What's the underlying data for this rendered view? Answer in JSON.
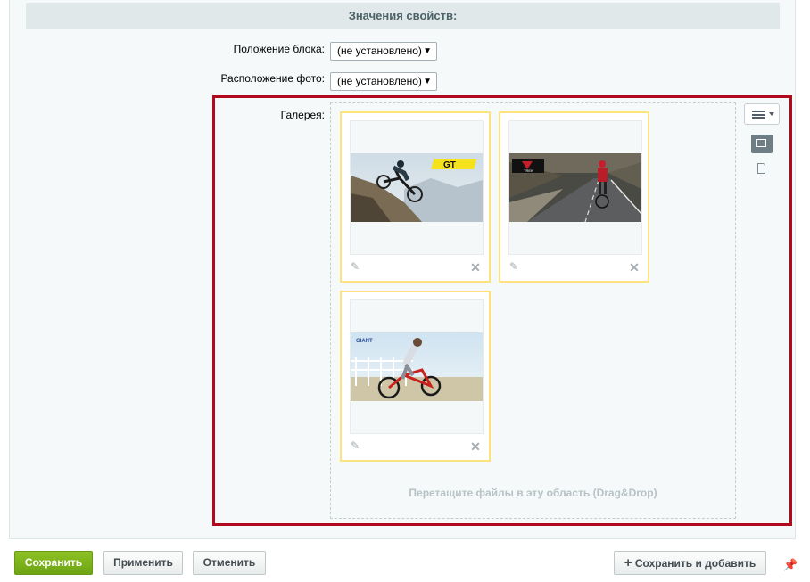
{
  "section": {
    "title": "Значения свойств:"
  },
  "fields": [
    {
      "label": "Положение блока:",
      "value": "(не установлено)"
    },
    {
      "label": "Расположение фото:",
      "value": "(не установлено)"
    }
  ],
  "gallery": {
    "label": "Галерея:",
    "dropzone_text": "Перетащите файлы в эту область (Drag&Drop)",
    "photos": [
      {
        "brand": "GT"
      },
      {
        "brand": "TREK"
      },
      {
        "brand": "GIANT"
      }
    ]
  },
  "icons": {
    "menu": "menu-icon",
    "grid_view": "image-view-icon",
    "file_view": "file-view-icon",
    "edit": "pencil-icon",
    "delete": "close-icon",
    "pin": "pin-icon"
  },
  "footer": {
    "save": "Сохранить",
    "apply": "Применить",
    "cancel": "Отменить",
    "save_add": "Сохранить и добавить"
  },
  "colors": {
    "accent_red": "#b10a1c",
    "card_border": "#fce37f",
    "save_green": "#79ab18"
  }
}
